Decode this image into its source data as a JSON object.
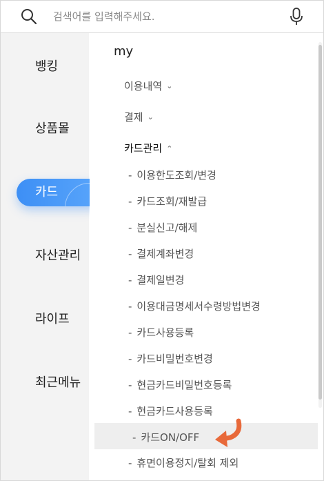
{
  "search": {
    "placeholder": "검색어를 입력해주세요."
  },
  "sidebar": {
    "items": [
      {
        "label": "뱅킹"
      },
      {
        "label": "상품몰"
      },
      {
        "label": "카드"
      },
      {
        "label": "자산관리"
      },
      {
        "label": "라이프"
      },
      {
        "label": "최근메뉴"
      }
    ],
    "active_color": "#3d8ff5"
  },
  "menu": {
    "section_title": "my",
    "groups": [
      {
        "label": "이용내역",
        "expanded": false
      },
      {
        "label": "결제",
        "expanded": false
      },
      {
        "label": "카드관리",
        "expanded": true
      }
    ],
    "items": [
      {
        "label": "이용한도조회/변경"
      },
      {
        "label": "카드조회/재발급"
      },
      {
        "label": "분실신고/해제"
      },
      {
        "label": "결제계좌변경"
      },
      {
        "label": "결제일변경"
      },
      {
        "label": "이용대금명세서수령방법변경"
      },
      {
        "label": "카드사용등록"
      },
      {
        "label": "카드비밀번호변경"
      },
      {
        "label": "현금카드비밀번호등록"
      },
      {
        "label": "현금카드사용등록"
      },
      {
        "label": "카드ON/OFF"
      },
      {
        "label": "휴면이용정지/탈회 제외"
      }
    ],
    "dash": "-",
    "highlighted_item": "카드ON/OFF"
  },
  "icons": {
    "search": "search-icon",
    "mic": "microphone-icon",
    "pointer_arrow": "curved-arrow-icon",
    "arrow_color": "#e8693a"
  }
}
